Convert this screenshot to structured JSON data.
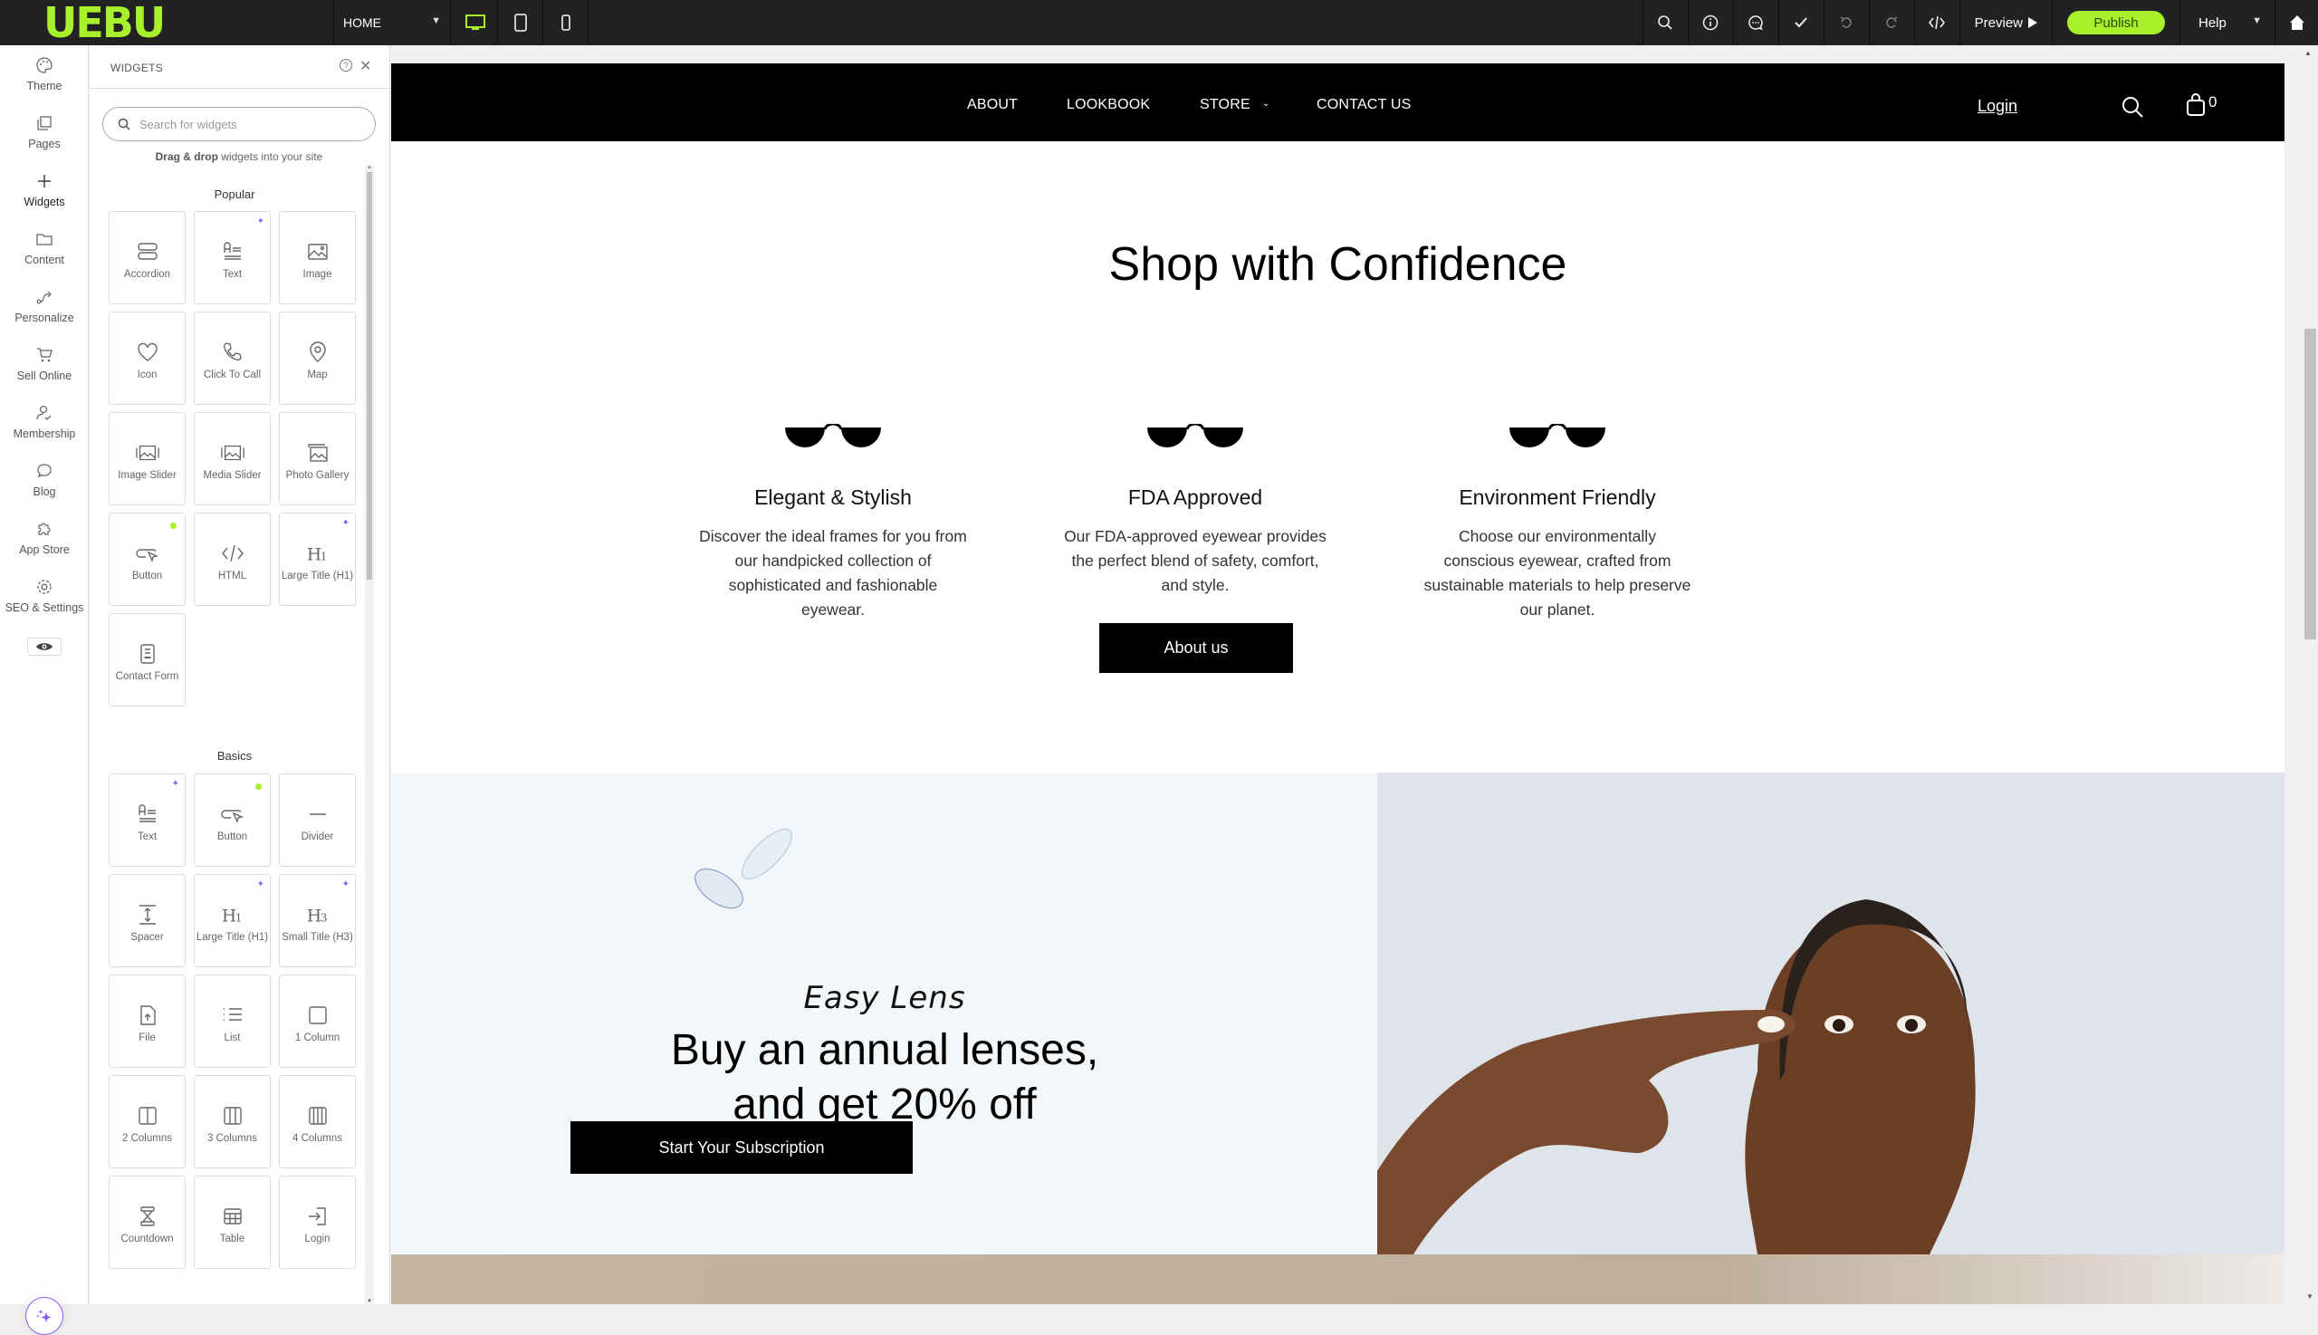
{
  "editor": {
    "logo": "UEBU",
    "page_select": "HOME",
    "devices": [
      "desktop",
      "tablet",
      "mobile"
    ],
    "toolbar": {
      "preview_label": "Preview",
      "publish_label": "Publish",
      "help_label": "Help"
    },
    "accent_color": "#a8ef2c"
  },
  "leftnav": {
    "items": [
      {
        "label": "Theme",
        "icon": "palette-icon"
      },
      {
        "label": "Pages",
        "icon": "pages-icon"
      },
      {
        "label": "Widgets",
        "icon": "plus-icon",
        "active": true
      },
      {
        "label": "Content",
        "icon": "folder-icon"
      },
      {
        "label": "Personalize",
        "icon": "route-icon"
      },
      {
        "label": "Sell Online",
        "icon": "cart-icon"
      },
      {
        "label": "Membership",
        "icon": "user-check-icon"
      },
      {
        "label": "Blog",
        "icon": "chat-bubble-icon"
      },
      {
        "label": "App Store",
        "icon": "puzzle-icon"
      },
      {
        "label": "SEO & Settings",
        "icon": "gear-icon"
      }
    ]
  },
  "widgets": {
    "title": "WIDGETS",
    "search_placeholder": "Search for widgets",
    "hint_bold": "Drag & drop",
    "hint_rest": " widgets into your site",
    "popular_title": "Popular",
    "popular": [
      {
        "label": "Accordion",
        "badge": ""
      },
      {
        "label": "Text",
        "badge": "ai"
      },
      {
        "label": "Image",
        "badge": ""
      },
      {
        "label": "Icon",
        "badge": ""
      },
      {
        "label": "Click To Call",
        "badge": ""
      },
      {
        "label": "Map",
        "badge": ""
      },
      {
        "label": "Image Slider",
        "badge": ""
      },
      {
        "label": "Media Slider",
        "badge": ""
      },
      {
        "label": "Photo Gallery",
        "badge": ""
      },
      {
        "label": "Button",
        "badge": "new"
      },
      {
        "label": "HTML",
        "badge": ""
      },
      {
        "label": "Large Title (H1)",
        "badge": "ai"
      },
      {
        "label": "Contact Form",
        "badge": ""
      }
    ],
    "basics_title": "Basics",
    "basics": [
      {
        "label": "Text",
        "badge": "ai"
      },
      {
        "label": "Button",
        "badge": "new"
      },
      {
        "label": "Divider",
        "badge": ""
      },
      {
        "label": "Spacer",
        "badge": ""
      },
      {
        "label": "Large Title (H1)",
        "badge": "ai"
      },
      {
        "label": "Small Title (H3)",
        "badge": "ai"
      },
      {
        "label": "File",
        "badge": ""
      },
      {
        "label": "List",
        "badge": ""
      },
      {
        "label": "1 Column",
        "badge": ""
      },
      {
        "label": "2 Columns",
        "badge": ""
      },
      {
        "label": "3 Columns",
        "badge": ""
      },
      {
        "label": "4 Columns",
        "badge": ""
      },
      {
        "label": "Countdown",
        "badge": ""
      },
      {
        "label": "Table",
        "badge": ""
      },
      {
        "label": "Login",
        "badge": ""
      }
    ]
  },
  "site": {
    "nav": [
      "ABOUT",
      "LOOKBOOK",
      "STORE",
      "CONTACT US"
    ],
    "login": "Login",
    "cart_count": "0",
    "section_title": "Shop with Confidence",
    "features": [
      {
        "title": "Elegant & Stylish",
        "text": "Discover the ideal frames for you from our handpicked collection of sophisticated and fashionable eyewear."
      },
      {
        "title": "FDA Approved",
        "text": "Our FDA-approved eyewear provides the perfect blend of safety, comfort, and style."
      },
      {
        "title": "Environment Friendly",
        "text": "Choose our environmentally conscious eyewear, crafted from sustainable materials to help preserve our planet."
      }
    ],
    "about_button": "About us",
    "promo": {
      "script_title": "Easy Lens",
      "title_line1": "Buy an annual lenses,",
      "title_line2": "and get 20% off",
      "button": "Start Your Subscription"
    }
  }
}
